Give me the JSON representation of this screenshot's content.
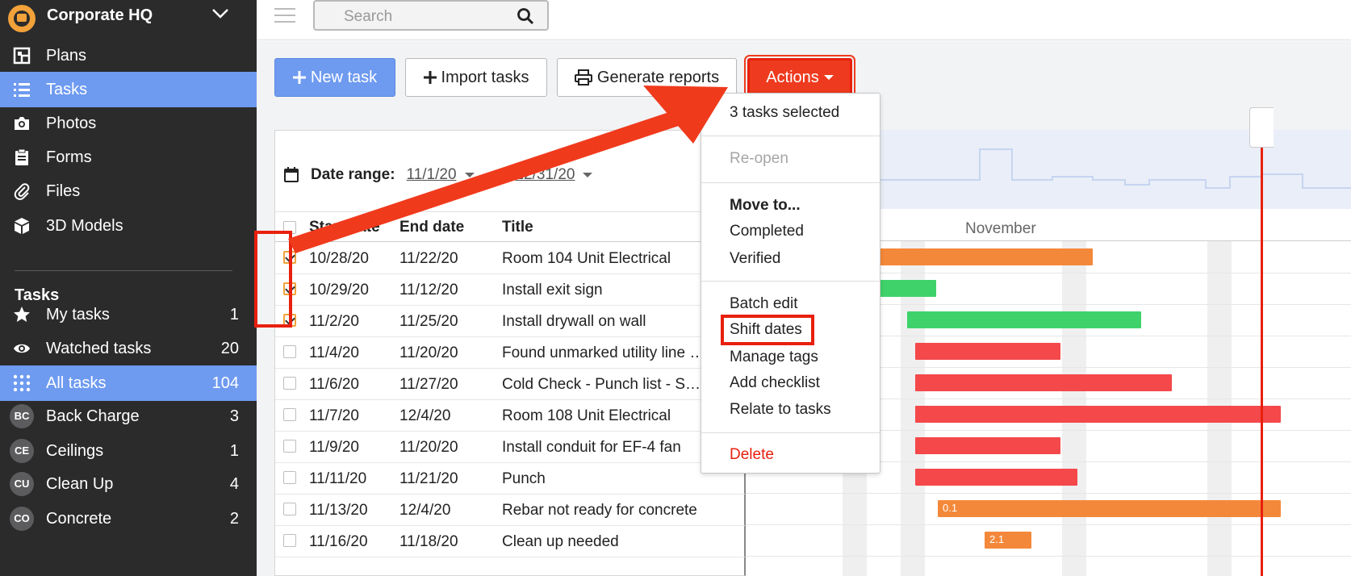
{
  "sidebar": {
    "org_name": "Corporate HQ",
    "nav": [
      {
        "label": "Plans",
        "icon": "plans-icon"
      },
      {
        "label": "Tasks",
        "icon": "tasks-list-icon",
        "active": true
      },
      {
        "label": "Photos",
        "icon": "camera-icon"
      },
      {
        "label": "Forms",
        "icon": "clipboard-icon"
      },
      {
        "label": "Files",
        "icon": "paperclip-icon"
      },
      {
        "label": "3D Models",
        "icon": "cube-icon"
      }
    ],
    "section_title": "Tasks",
    "task_filters": [
      {
        "label": "My tasks",
        "count": "1",
        "icon": "star-icon"
      },
      {
        "label": "Watched tasks",
        "count": "20",
        "icon": "eye-icon"
      },
      {
        "label": "All tasks",
        "count": "104",
        "icon": "grid-icon",
        "active": true
      },
      {
        "label": "Back Charge",
        "count": "3",
        "badge": "BC"
      },
      {
        "label": "Ceilings",
        "count": "1",
        "badge": "CE"
      },
      {
        "label": "Clean Up",
        "count": "4",
        "badge": "CU"
      },
      {
        "label": "Concrete",
        "count": "2",
        "badge": "CO"
      }
    ]
  },
  "topbar": {
    "search_placeholder": "Search"
  },
  "toolbar": {
    "new_task": "New task",
    "import_tasks": "Import tasks",
    "generate_reports": "Generate reports",
    "actions": "Actions"
  },
  "table": {
    "date_range_label": "Date range:",
    "date_from": "11/1/20",
    "date_to": "12/31/20",
    "columns": {
      "start": "Start date",
      "end": "End date",
      "title": "Title"
    },
    "rows": [
      {
        "start": "10/28/20",
        "end": "11/22/20",
        "title": "Room 104 Unit Electrical",
        "checked": true
      },
      {
        "start": "10/29/20",
        "end": "11/12/20",
        "title": "Install exit sign",
        "checked": true
      },
      {
        "start": "11/2/20",
        "end": "11/25/20",
        "title": "Install drywall on wall",
        "checked": true
      },
      {
        "start": "11/4/20",
        "end": "11/20/20",
        "title": "Found unmarked utility line in ...",
        "checked": false
      },
      {
        "start": "11/6/20",
        "end": "11/27/20",
        "title": "Cold Check - Punch list - Skid-...",
        "checked": false
      },
      {
        "start": "11/7/20",
        "end": "12/4/20",
        "title": "Room 108 Unit Electrical",
        "checked": false
      },
      {
        "start": "11/9/20",
        "end": "11/20/20",
        "title": "Install conduit for EF-4 fan",
        "checked": false
      },
      {
        "start": "11/11/20",
        "end": "11/21/20",
        "title": "Punch",
        "checked": false
      },
      {
        "start": "11/13/20",
        "end": "12/4/20",
        "title": "Rebar not ready for concrete",
        "checked": false
      },
      {
        "start": "11/16/20",
        "end": "11/18/20",
        "title": "Clean up needed",
        "checked": false
      }
    ]
  },
  "gantt": {
    "month_label": "November",
    "bar_labels": [
      "0.1",
      "2.1"
    ],
    "colors": {
      "orange": "#f4883a",
      "green": "#3fd26a",
      "red": "#f4484a",
      "today": "#e8200d"
    }
  },
  "menu": {
    "selected_count": "3 tasks selected",
    "reopen": "Re-open",
    "move_to": "Move to...",
    "completed": "Completed",
    "verified": "Verified",
    "batch_edit": "Batch edit",
    "shift_dates": "Shift dates",
    "manage_tags": "Manage tags",
    "add_checklist": "Add checklist",
    "relate_to_tasks": "Relate to tasks",
    "delete": "Delete"
  },
  "colors": {
    "sidebar_bg": "#2b2b2c",
    "active_bg": "#6e9af0",
    "accent_red": "#e8200d",
    "checkbox_orange": "#f1a33a"
  }
}
